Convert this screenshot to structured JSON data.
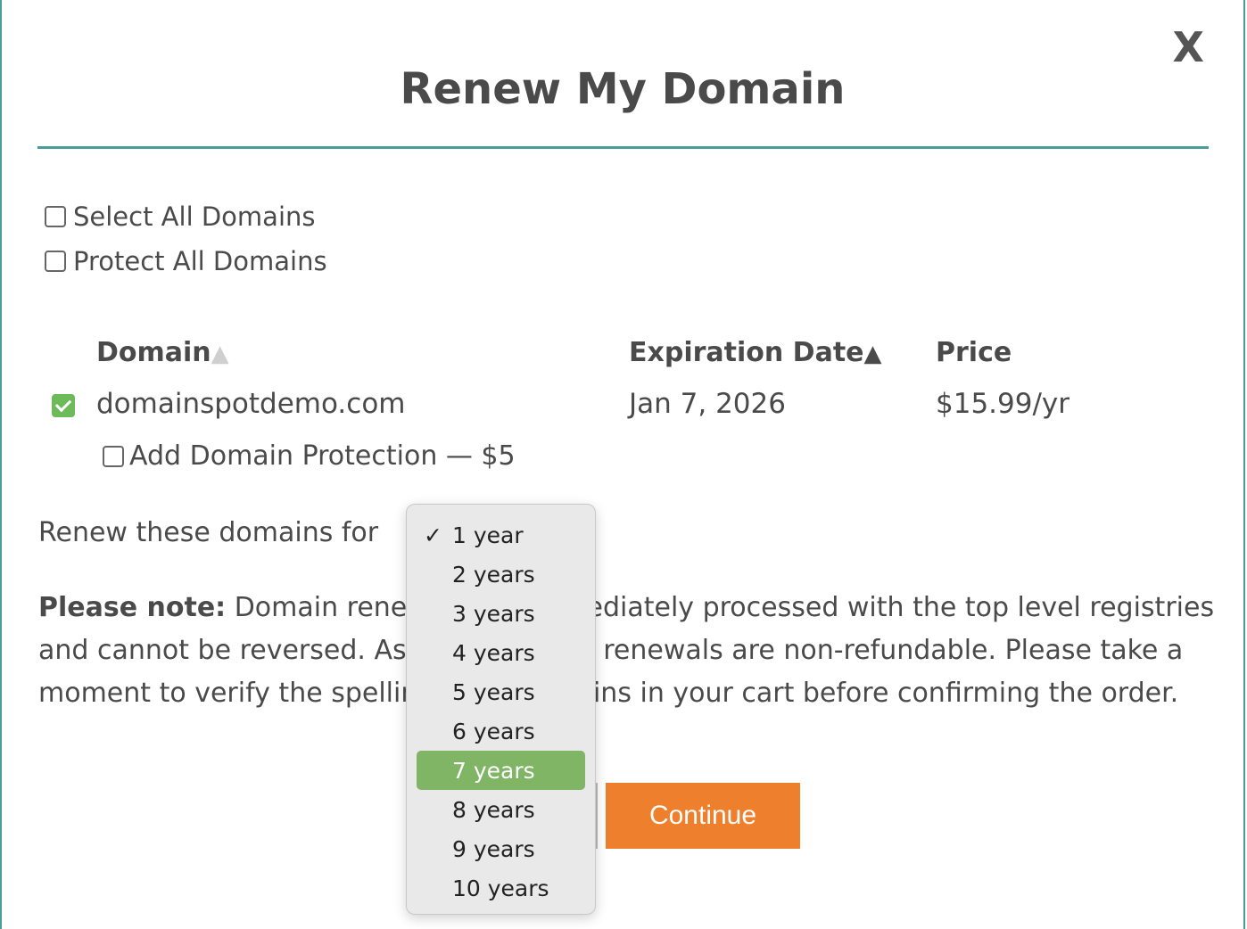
{
  "modal": {
    "close_label": "X",
    "title": "Renew My Domain"
  },
  "options": {
    "select_all": "Select All Domains",
    "protect_all": "Protect All Domains"
  },
  "table": {
    "headers": {
      "domain": "Domain",
      "expiration": "Expiration Date",
      "price": "Price"
    },
    "sort_arrow": "▲",
    "rows": [
      {
        "checked": true,
        "domain": "domainspotdemo.com",
        "expiration": "Jan 7, 2026",
        "price": "$15.99/yr",
        "protection_label": "Add Domain Protection — $5"
      }
    ]
  },
  "renew": {
    "label": "Renew these domains for",
    "selected": "1 year",
    "highlighted": "7 years",
    "options": [
      "1 year",
      "2 years",
      "3 years",
      "4 years",
      "5 years",
      "6 years",
      "7 years",
      "8 years",
      "9 years",
      "10 years"
    ]
  },
  "note": {
    "bold": "Please note:",
    "text": " Domain renewals are immediately processed with the top level registries and cannot be reversed. As such, domain renewals are non-refundable. Please take a moment to verify the spelling of all domains in your cart before confirming the order."
  },
  "buttons": {
    "continue": "Continue"
  },
  "colors": {
    "accent": "#4a9c9c",
    "continue": "#ee7f2d",
    "checked": "#6cba5a",
    "highlight": "#7fb564"
  }
}
